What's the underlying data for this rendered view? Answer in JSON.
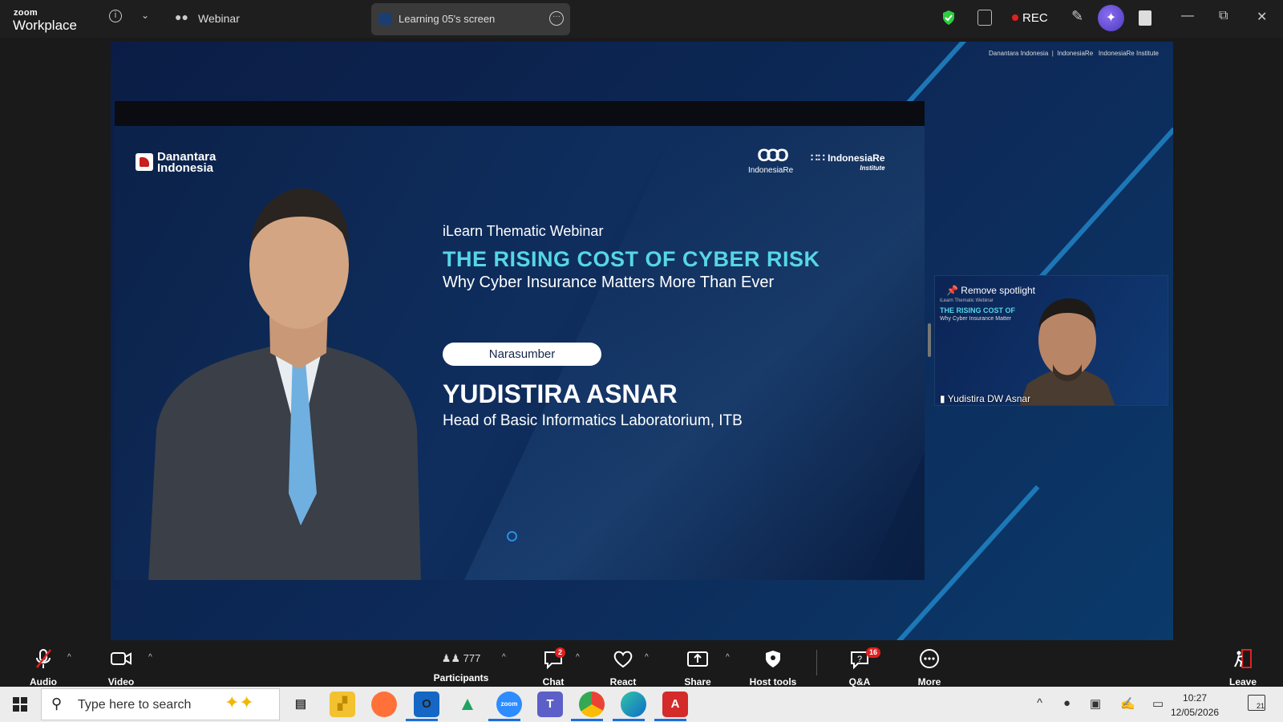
{
  "titlebar": {
    "brand_top": "zoom",
    "brand_bottom": "Workplace",
    "webinar_label": "Webinar",
    "screen_tab_label": "Learning 05's screen",
    "rec_label": "REC",
    "colors": {
      "rec": "#e02020",
      "shield": "#2ecc40",
      "ai": "#6b4fe0"
    }
  },
  "share": {
    "header_logos": {
      "left": "Danantara Indonesia",
      "mid": "IndonesiaRe",
      "right": "IndonesiaRe Institute"
    }
  },
  "slide": {
    "logo_danantara": "Danantara\nIndonesia",
    "logo_ire": "IndonesiaRe",
    "logo_iri": "IndonesiaRe",
    "logo_iri_sub": "Institute",
    "kicker": "iLearn Thematic Webinar",
    "title": "THE RISING COST OF CYBER RISK",
    "subtitle": "Why Cyber Insurance Matters More Than Ever",
    "pill": "Narasumber",
    "speaker": "YUDISTIRA ASNAR",
    "role": "Head of Basic Informatics Laboratorium, ITB",
    "colors": {
      "title": "#56d6e8",
      "background": "#0f2e5e"
    }
  },
  "thumbnail": {
    "spotlight": "Remove spotlight",
    "mini_kicker": "iLearn Thematic Webinar",
    "mini_title": "THE RISING COST OF",
    "mini_sub": "Why Cyber Insurance Matter",
    "name": "Yudistira DW Asnar"
  },
  "controls": {
    "audio": "Audio",
    "video": "Video",
    "participants": "Participants",
    "participants_count": "777",
    "chat": "Chat",
    "chat_badge": "2",
    "react": "React",
    "share": "Share",
    "host_tools": "Host tools",
    "qa": "Q&A",
    "qa_badge": "16",
    "more": "More",
    "leave": "Leave"
  },
  "taskbar": {
    "search_placeholder": "Type here to search",
    "apps": [
      "task-view",
      "file-explorer",
      "firefox",
      "outlook",
      "google-drive",
      "zoom",
      "teams",
      "chrome",
      "edge",
      "acrobat"
    ],
    "time": "10:27",
    "date": "12/05/2026",
    "notifications": "21"
  }
}
